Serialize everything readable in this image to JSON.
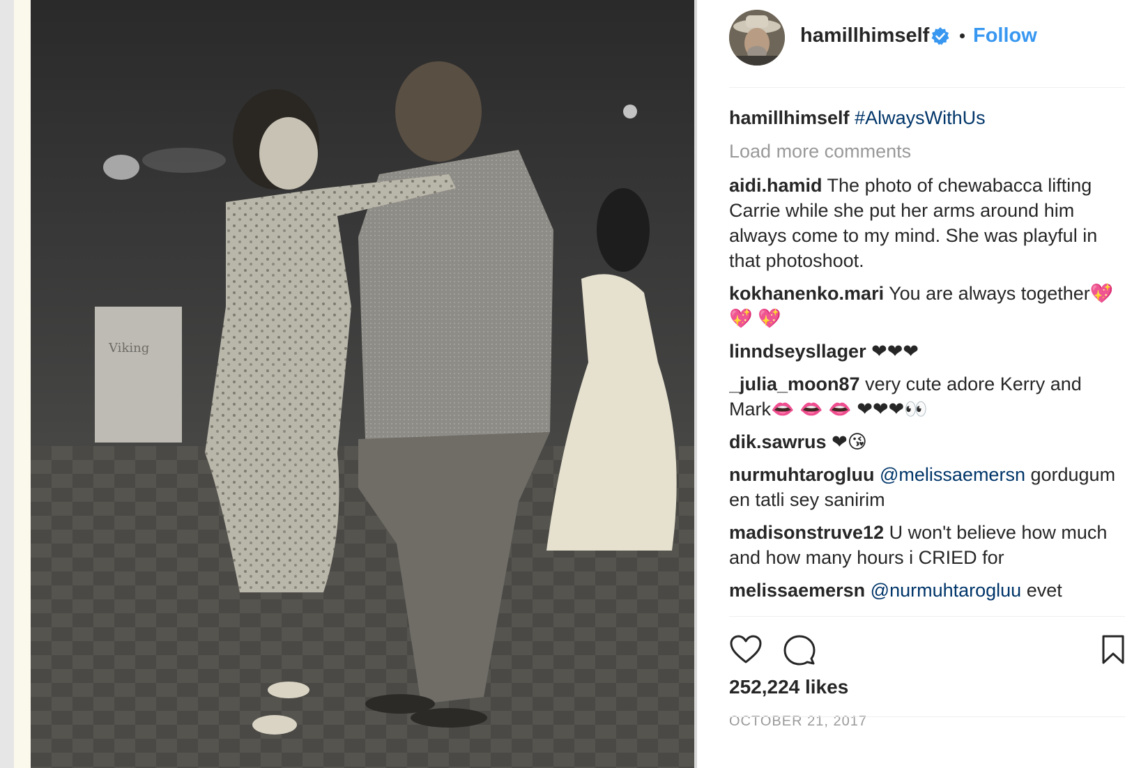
{
  "post": {
    "author": {
      "username": "hamillhimself",
      "verified_icon": "verified-badge-icon",
      "follow_label": "Follow"
    },
    "caption": {
      "username": "hamillhimself",
      "text": "#AlwaysWithUs"
    },
    "load_more_label": "Load more comments",
    "comments": [
      {
        "username": "aidi.hamid",
        "text": "The photo of chewabacca lifting Carrie while she put her arms around him always come to my mind. She was playful in that photoshoot."
      },
      {
        "username": "kokhanenko.mari",
        "text": "You are always together💖 💖 💖"
      },
      {
        "username": "linndseysllager",
        "text": "❤❤❤"
      },
      {
        "username": "_julia_moon87",
        "text": "very cute adore Kerry and Mark👄 👄 👄 ❤❤❤👀"
      },
      {
        "username": "dik.sawrus",
        "text": "❤😘"
      },
      {
        "username": "nurmuhtarogluu",
        "mention": "@melissaemersn",
        "text": "gordugum en tatli sey sanirim"
      },
      {
        "username": "madisonstruve12",
        "text": "U won't believe how much and how many hours i CRIED for"
      },
      {
        "username": "melissaemersn",
        "mention": "@nurmuhtarogluu",
        "text": "evet"
      }
    ],
    "actions": {
      "like_icon": "heart-icon",
      "comment_icon": "comment-bubble-icon",
      "save_icon": "bookmark-icon"
    },
    "likes_text": "252,224 likes",
    "date_text": "OCTOBER 21, 2017"
  },
  "colors": {
    "accent": "#3897f0",
    "hashtag": "#003569",
    "muted": "#999999",
    "text": "#262626"
  }
}
